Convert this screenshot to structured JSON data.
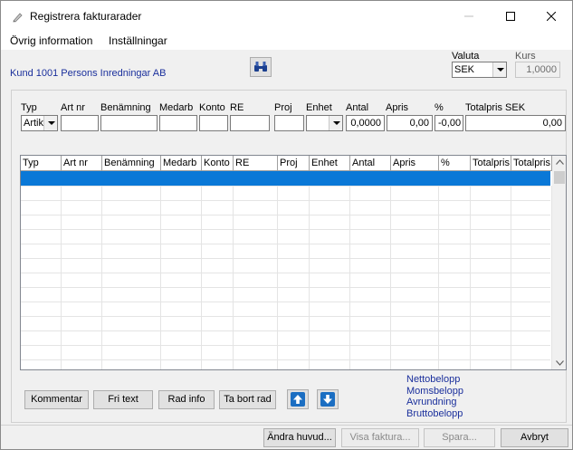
{
  "window": {
    "title": "Registrera fakturarader"
  },
  "menu": {
    "items": [
      "Övrig information",
      "Inställningar"
    ]
  },
  "header": {
    "customer": "Kund 1001 Persons Inredningar AB",
    "currency_label": "Valuta",
    "currency_value": "SEK",
    "rate_label": "Kurs",
    "rate_value": "1,0000",
    "search_icon": "binoculars-icon"
  },
  "entry": {
    "labels": {
      "typ": "Typ",
      "artnr": "Art nr",
      "benamning": "Benämning",
      "medarb": "Medarb",
      "konto": "Konto",
      "re": "RE",
      "proj": "Proj",
      "enhet": "Enhet",
      "antal": "Antal",
      "apris": "Apris",
      "procent": "%",
      "totalpris": "Totalpris SEK"
    },
    "values": {
      "typ": "Artik",
      "artnr": "",
      "benamning": "",
      "medarb": "",
      "konto": "",
      "re": "",
      "proj": "",
      "enhet": "",
      "antal": "0,0000",
      "apris": "0,00",
      "procent": "-0,00",
      "totalpris": "0,00"
    }
  },
  "grid": {
    "columns": [
      "Typ",
      "Art nr",
      "Benämning",
      "Medarb",
      "Konto",
      "RE",
      "Proj",
      "Enhet",
      "Antal",
      "Apris",
      "%",
      "Totalpris",
      "Totalpris"
    ]
  },
  "actions": {
    "kommentar": "Kommentar",
    "fritext": "Fri text",
    "radinfo": "Rad info",
    "tabortrad": "Ta bort rad",
    "up_icon": "arrow-up-icon",
    "down_icon": "arrow-down-icon"
  },
  "totals": {
    "netto": "Nettobelopp",
    "moms": "Momsbelopp",
    "avrundning": "Avrundning",
    "brutto": "Bruttobelopp"
  },
  "footer": {
    "andra_huvud": "Ändra huvud...",
    "visa_faktura": "Visa faktura...",
    "spara": "Spara...",
    "avbryt": "Avbryt"
  },
  "colors": {
    "selection": "#0a78d7",
    "label_blue": "#1a2f9c",
    "accent_button_icon": "#1b6ec2"
  }
}
